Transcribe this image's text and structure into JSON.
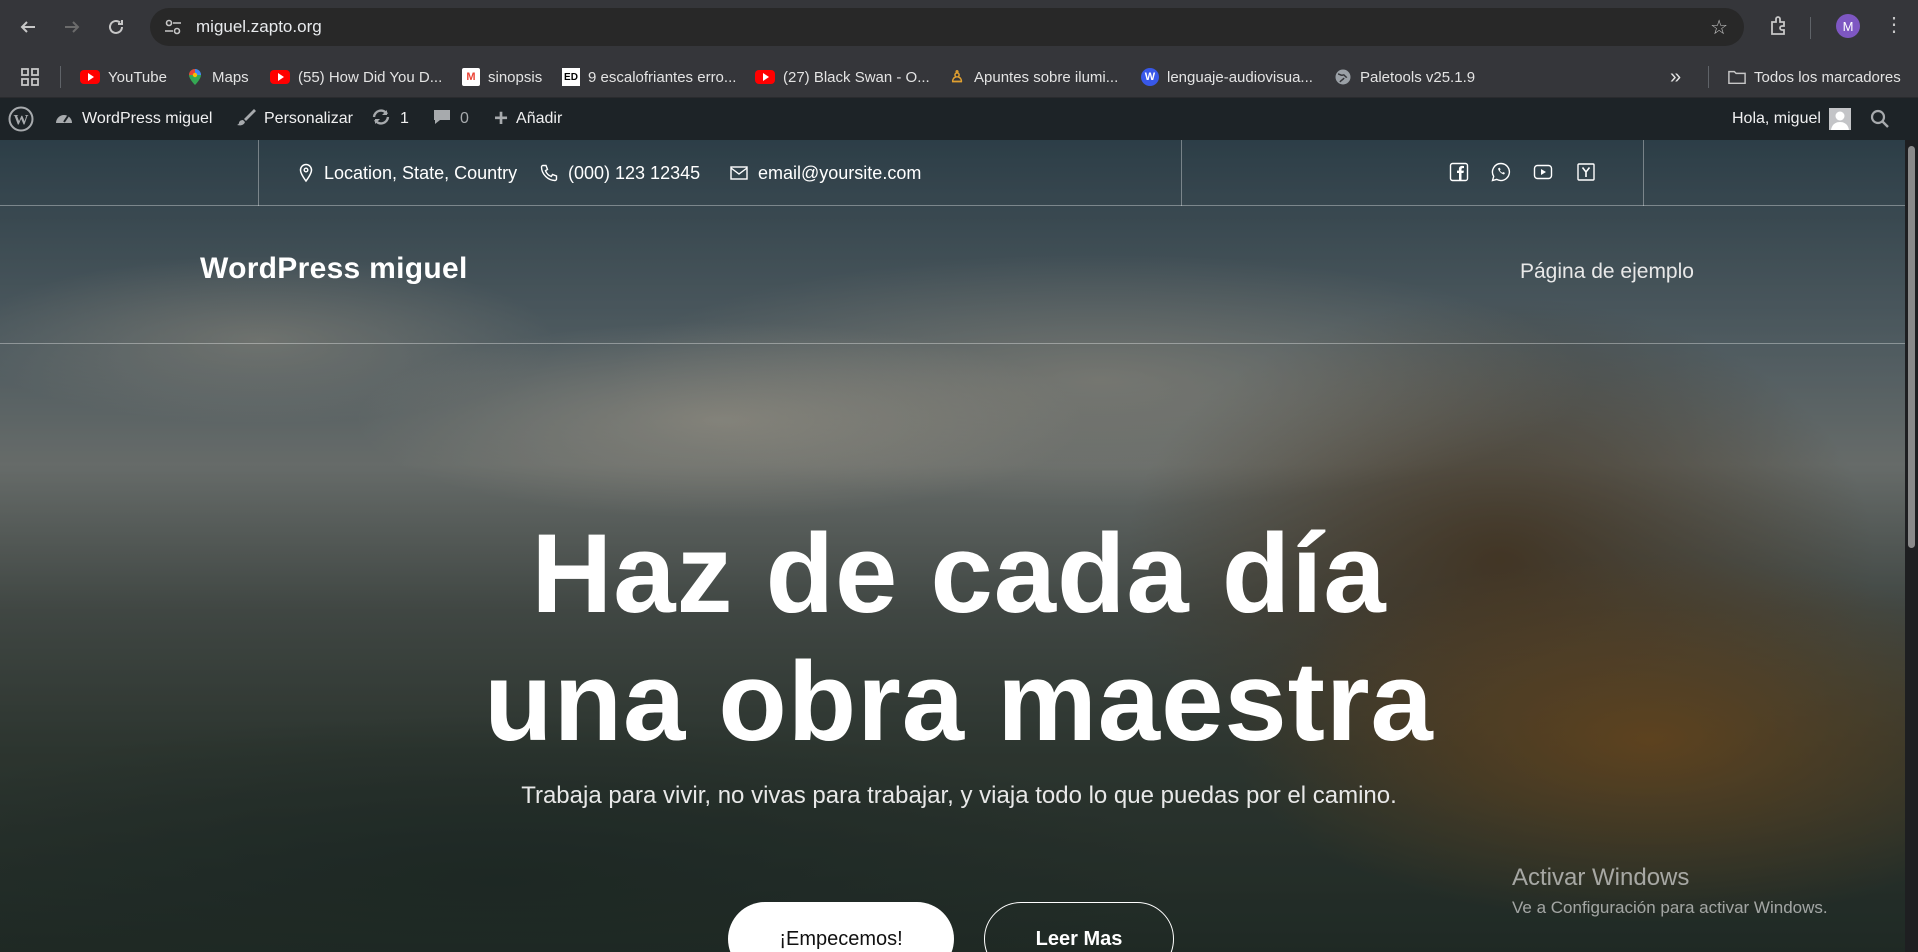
{
  "browser": {
    "url": "miguel.zapto.org",
    "profile_initial": "M",
    "bookmarks": [
      {
        "label": "YouTube",
        "icon": "youtube-icon"
      },
      {
        "label": "Maps",
        "icon": "maps-icon"
      },
      {
        "label": "(55) How Did You D...",
        "icon": "youtube-icon"
      },
      {
        "label": "sinopsis",
        "icon": "gmail-icon"
      },
      {
        "label": "9 escalofriantes erro...",
        "icon": "ed-icon"
      },
      {
        "label": "(27) Black Swan - O...",
        "icon": "youtube-icon"
      },
      {
        "label": "Apuntes sobre ilumi...",
        "icon": "figure-icon"
      },
      {
        "label": "lenguaje-audiovisua...",
        "icon": "wordpress-icon"
      },
      {
        "label": "Paletools v25.1.9",
        "icon": "globe-icon"
      }
    ],
    "overflow": "»",
    "all_bookmarks": "Todos los marcadores"
  },
  "wp_admin": {
    "site_name": "WordPress miguel",
    "customize": "Personalizar",
    "updates": "1",
    "comments": "0",
    "add_new": "Añadir",
    "greeting": "Hola, miguel"
  },
  "site": {
    "topbar": {
      "location": "Location, State, Country",
      "phone": "(000) 123 12345",
      "email": "email@yoursite.com"
    },
    "brand": "WordPress miguel",
    "menu_link": "Página de ejemplo",
    "hero_line1": "Haz de cada día",
    "hero_line2": "una obra maestra",
    "hero_sub": "Trabaja para vivir, no vivas para trabajar, y viaja todo lo que puedas por el camino.",
    "cta_primary": "¡Empecemos!",
    "cta_secondary": "Leer Mas"
  },
  "windows_watermark": {
    "title": "Activar Windows",
    "subtitle": "Ve a Configuración para activar Windows."
  }
}
